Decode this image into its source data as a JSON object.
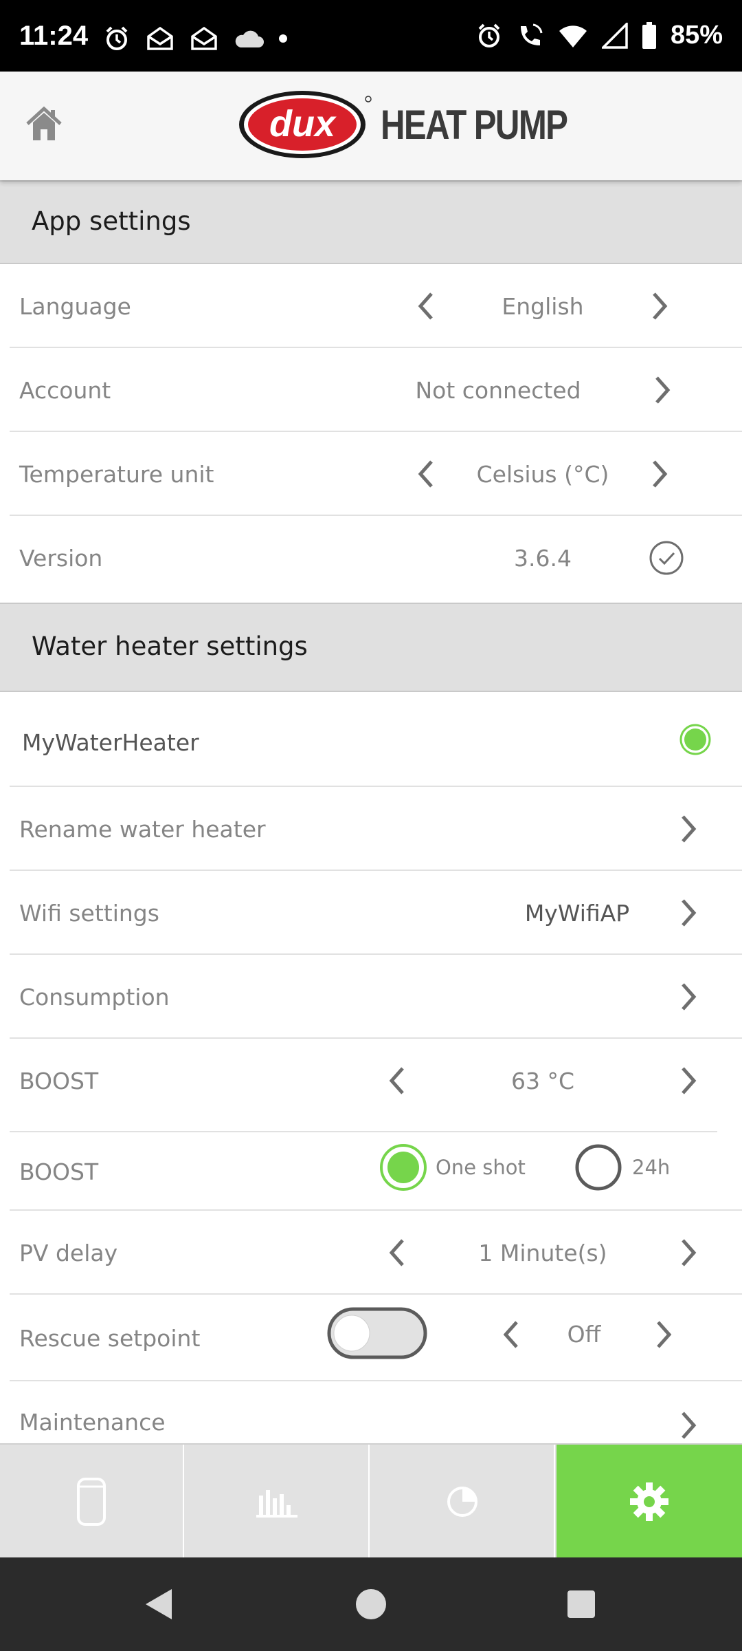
{
  "status_bar": {
    "time": "11:24",
    "battery": "85%",
    "icons_left": [
      "alarm-icon",
      "mail-icon",
      "mail-icon",
      "cloud-icon",
      "dot-icon"
    ],
    "icons_right": [
      "alarm-icon",
      "wifi-call-icon",
      "wifi-icon",
      "signal-icon",
      "battery-icon"
    ]
  },
  "app_bar": {
    "logo_badge": "dux",
    "logo_text": "HEAT PUMP",
    "home_icon": "home-icon"
  },
  "app_settings": {
    "title": "App settings",
    "language": {
      "label": "Language",
      "value": "English"
    },
    "account": {
      "label": "Account",
      "value": "Not connected"
    },
    "temperature_unit": {
      "label": "Temperature unit",
      "value": "Celsius (°C)"
    },
    "version": {
      "label": "Version",
      "value": "3.6.4"
    }
  },
  "water_heater_settings": {
    "title": "Water heater settings",
    "device": {
      "name": "MyWaterHeater",
      "status_color": "#76d54b"
    },
    "rename": {
      "label": "Rename water heater"
    },
    "wifi": {
      "label": "Wifi settings",
      "value": "MyWifiAP"
    },
    "consumption": {
      "label": "Consumption"
    },
    "boost_temp": {
      "label": "BOOST",
      "value": "63 °C"
    },
    "boost_mode": {
      "label": "BOOST",
      "options": [
        {
          "label": "One shot",
          "selected": true
        },
        {
          "label": "24h",
          "selected": false
        }
      ]
    },
    "pv_delay": {
      "label": "PV delay",
      "value": "1 Minute(s)"
    },
    "rescue_setpoint": {
      "label": "Rescue setpoint",
      "toggle_on": false,
      "value": "Off"
    },
    "maintenance": {
      "label": "Maintenance"
    }
  },
  "bottom_nav": {
    "tabs": [
      "tank-icon",
      "bar-chart-icon",
      "pie-chart-icon",
      "gear-icon"
    ],
    "active_tab": "gear-icon"
  },
  "colors": {
    "accent": "#76d54b",
    "section_bg": "#e0e0e0",
    "logo_red": "#d8202a"
  }
}
